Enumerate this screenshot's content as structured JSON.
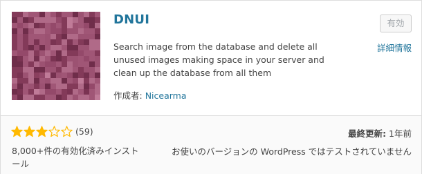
{
  "plugin": {
    "title": "DNUI",
    "description": "Search image from the database and delete all unused images making space in your server and clean up the database from all them",
    "author_label": "作成者:",
    "author_name": "Nicearma",
    "active_button": "有効",
    "more_details": "詳細情報"
  },
  "footer": {
    "rating": {
      "stars": 3,
      "max": 5,
      "count": "(59)"
    },
    "installs": "8,000+件の有効化済みインストール",
    "last_updated_label": "最終更新:",
    "last_updated_value": "1年前",
    "compatibility": "お使いのバージョンの WordPress ではテストされていません"
  },
  "colors": {
    "link": "#21759b",
    "star": "#ffb900",
    "thumbnail": "#8a3f5e"
  },
  "icons": {
    "thumbnail": "pixelated-pattern-thumbnail",
    "star_filled": "star-filled-icon",
    "star_empty": "star-empty-icon"
  }
}
